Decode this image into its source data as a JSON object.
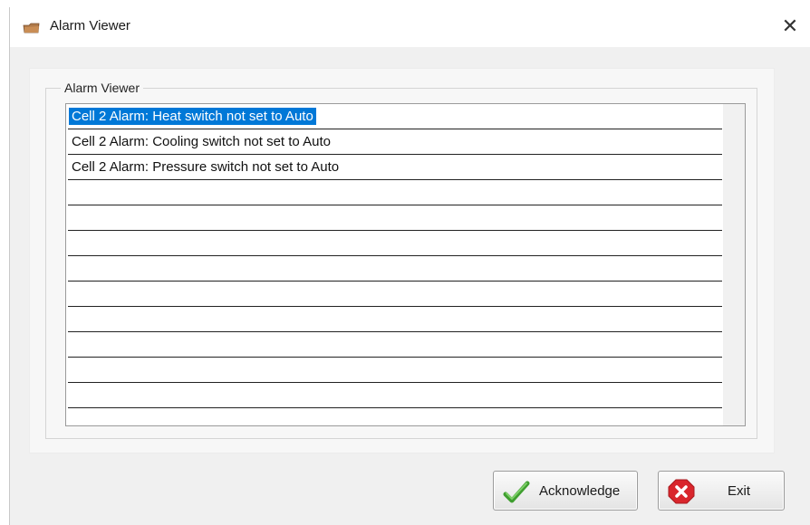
{
  "window": {
    "title": "Alarm Viewer",
    "close_symbol": "✕"
  },
  "group": {
    "label": "Alarm Viewer"
  },
  "alarms": {
    "items": [
      "Cell 2 Alarm: Heat switch not set to Auto",
      "Cell 2 Alarm: Cooling switch not set to Auto",
      "Cell 2 Alarm: Pressure switch not set to Auto",
      "",
      "",
      "",
      "",
      "",
      "",
      "",
      "",
      "",
      "",
      ""
    ],
    "selected_index": 0
  },
  "buttons": {
    "acknowledge_label": "Acknowledge",
    "exit_label": "Exit"
  },
  "icons": {
    "title": "folder-icon",
    "acknowledge": "checkmark-icon",
    "exit": "exit-x-icon"
  },
  "colors": {
    "selection": "#0078d7",
    "check_green": "#4caf3a",
    "exit_red": "#d9262c"
  }
}
